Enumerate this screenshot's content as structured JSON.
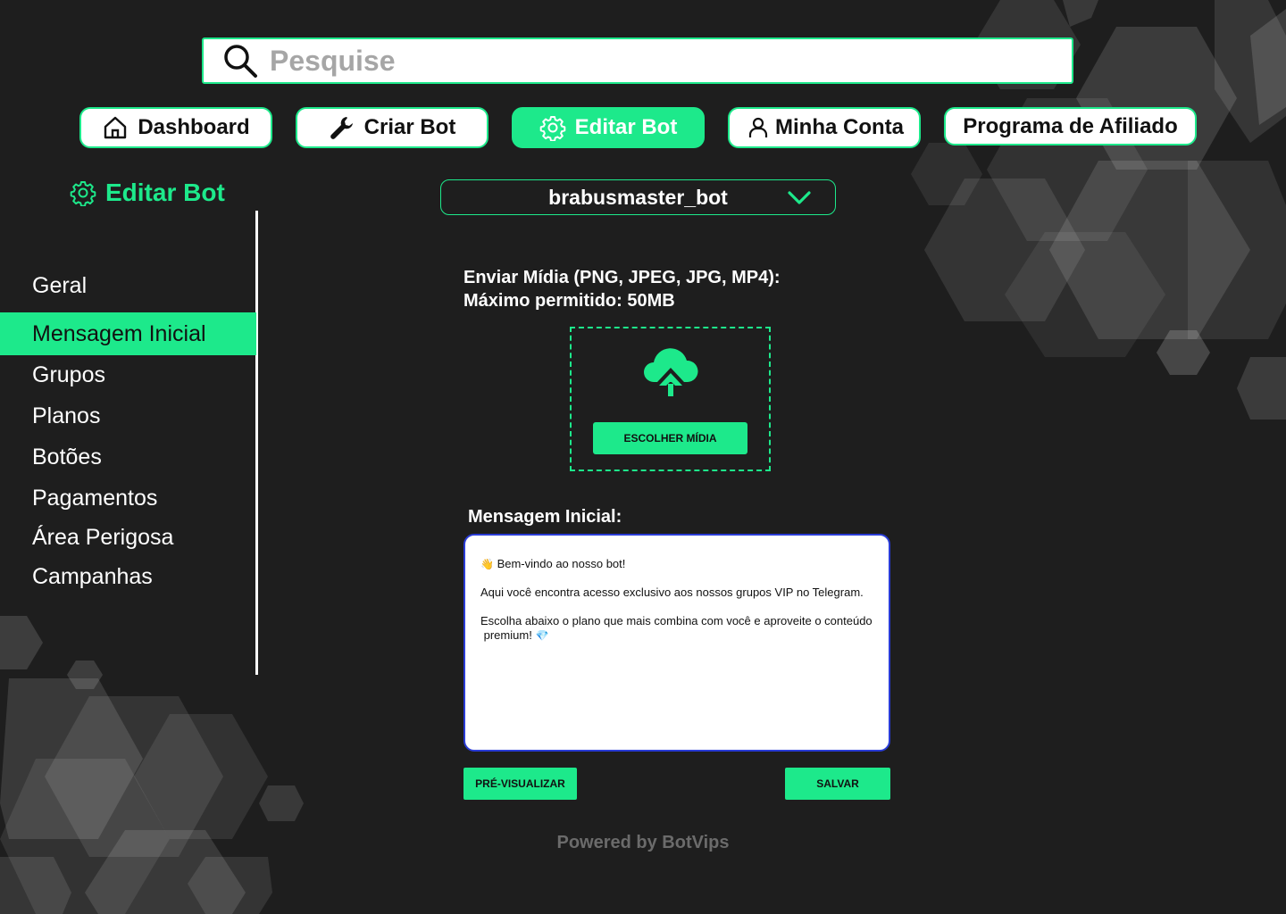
{
  "search": {
    "placeholder": "Pesquise",
    "icon": "search-icon"
  },
  "nav": [
    {
      "label": "Dashboard",
      "icon": "home-icon",
      "active": false
    },
    {
      "label": "Criar Bot",
      "icon": "wrench-icon",
      "active": false
    },
    {
      "label": "Editar Bot",
      "icon": "gear-icon",
      "active": true
    },
    {
      "label": "Minha Conta",
      "icon": "user-icon",
      "active": false
    },
    {
      "label": "Programa de Afiliado",
      "icon": "",
      "active": false
    }
  ],
  "sidebar": {
    "title": "Editar Bot",
    "title_icon": "gear-icon",
    "items": [
      {
        "label": "Geral"
      },
      {
        "label": "Mensagem Inicial",
        "active": true
      },
      {
        "label": "Grupos"
      },
      {
        "label": "Planos"
      },
      {
        "label": "Botões"
      },
      {
        "label": "Pagamentos"
      },
      {
        "label": "Área Perigosa"
      },
      {
        "label": "Campanhas"
      }
    ]
  },
  "bot_select": {
    "value": "brabusmaster_bot",
    "icon": "chevron-down-icon"
  },
  "media": {
    "label_line1": "Enviar Mídia (PNG, JPEG, JPG, MP4):",
    "label_line2": "Máximo permitido: 50MB",
    "upload_icon": "cloud-upload-icon",
    "choose_button": "ESCOLHER MÍDIA"
  },
  "message": {
    "label": "Mensagem Inicial:",
    "line1_emoji": "👋",
    "line1": "Bem-vindo ao nosso bot!",
    "line2": "Aqui você encontra acesso exclusivo aos nossos grupos VIP no Telegram.",
    "line3": "Escolha abaixo o plano que mais combina com você e aproveite o conteúdo",
    "line4": "premium!",
    "line4_emoji": "💎"
  },
  "actions": {
    "preview": "PRÉ-VISUALIZAR",
    "save": "SALVAR"
  },
  "footer": {
    "powered": "Powered by BotVips"
  },
  "colors": {
    "accent": "#1de98b",
    "background": "#1e1e1e",
    "textarea_border": "#2a3cd6"
  }
}
